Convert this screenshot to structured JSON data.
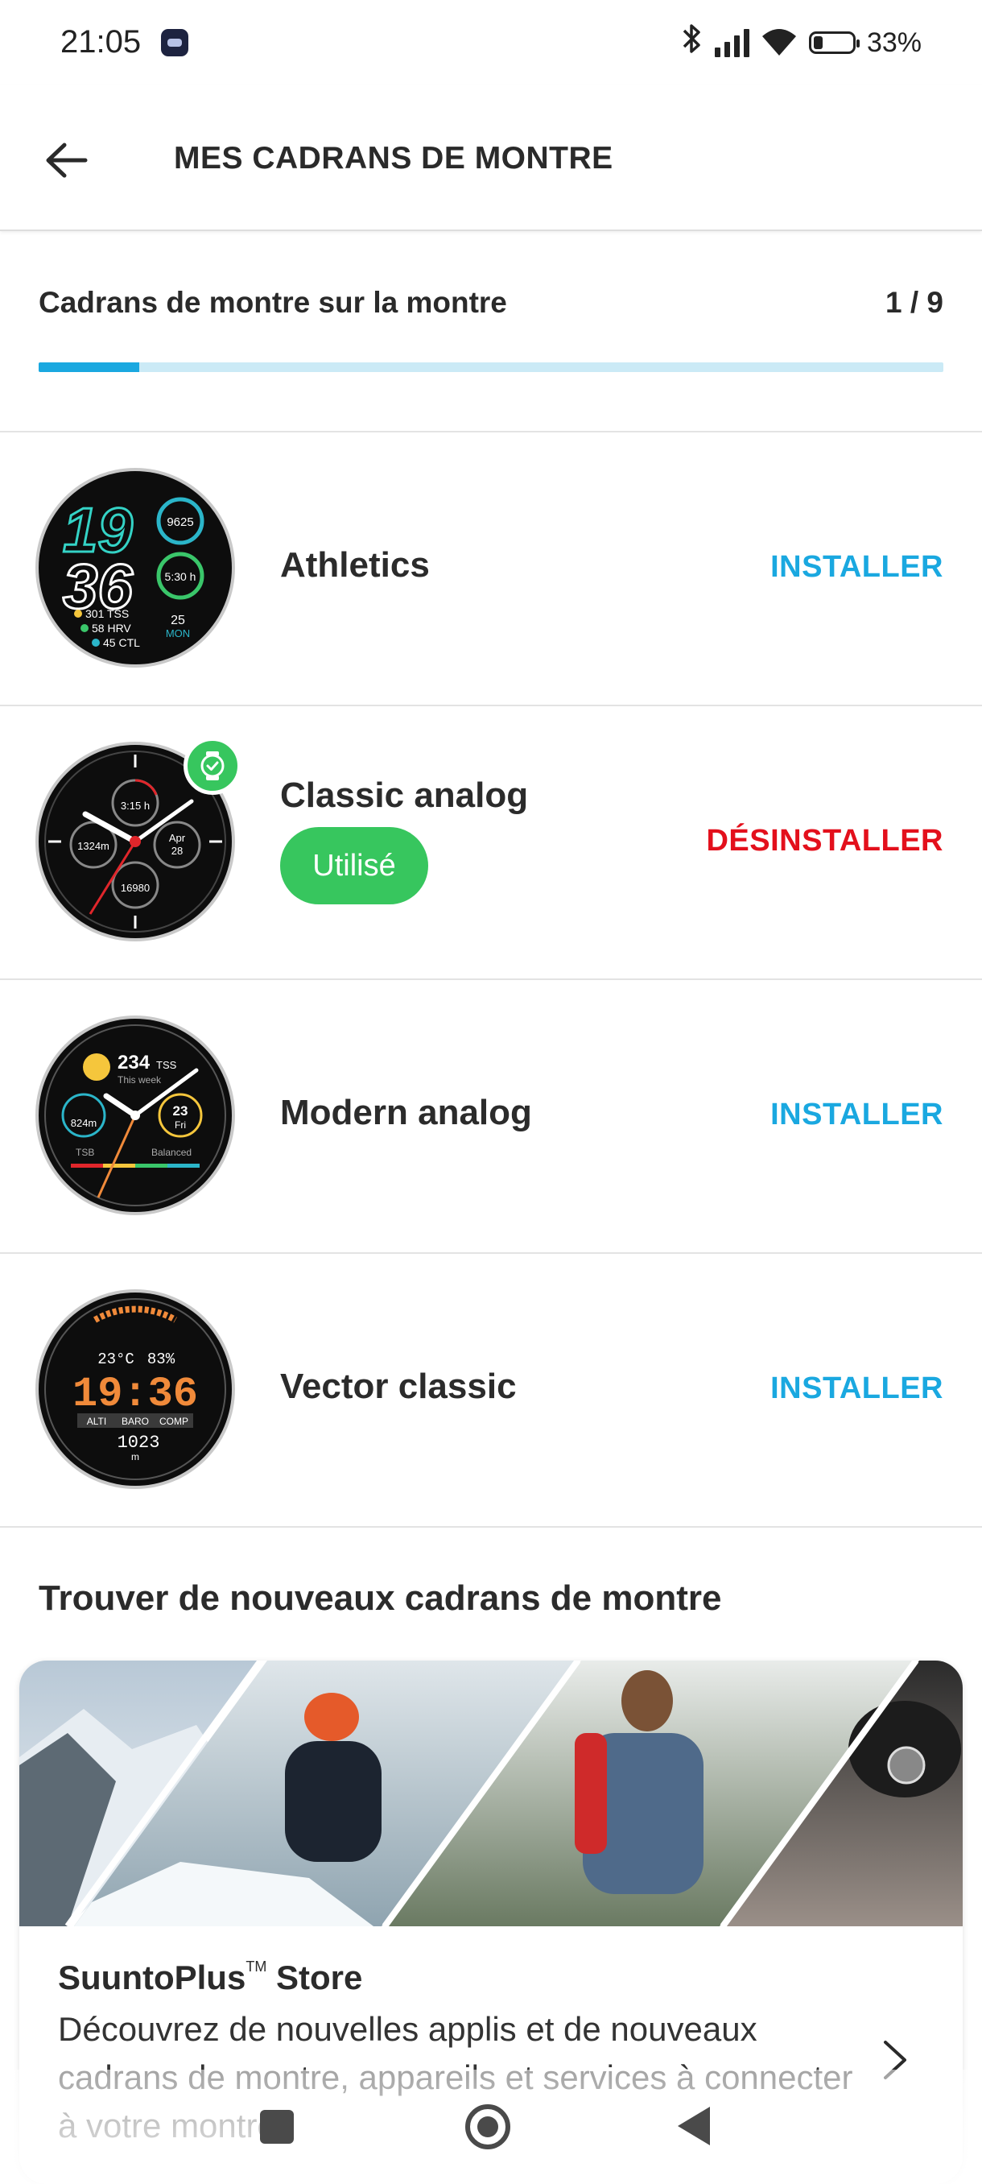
{
  "status_bar": {
    "time": "21:05",
    "app_icon": "notification-app-icon",
    "bluetooth_icon": "bluetooth-icon",
    "signal_icon": "cellular-signal-icon",
    "wifi_icon": "wifi-icon",
    "battery_icon": "battery-icon",
    "battery_percent": "33%",
    "battery_level": 0.33
  },
  "app_bar": {
    "back_icon": "arrow-back-icon",
    "title": "MES CADRANS DE MONTRE"
  },
  "installed_progress": {
    "label": "Cadrans de montre sur la montre",
    "count": "1 / 9",
    "fraction": 0.111
  },
  "colors": {
    "accent": "#1aa8e0",
    "danger": "#e3101c",
    "used_green": "#37c65e"
  },
  "watch_faces": [
    {
      "name": "Athletics",
      "action": "INSTALLER",
      "thumbnail": {
        "hours": "19",
        "minutes": "36",
        "steps": "9625",
        "sleep": "5:30 h",
        "tss": "301 TSS",
        "hrv": "58 HRV",
        "ctl": "45 CTL",
        "day": "25",
        "weekday": "MON"
      }
    },
    {
      "name": "Classic analog",
      "badge": "Utilisé",
      "action": "DÉSINSTALLER",
      "active_icon": "watch-check-icon",
      "thumbnail": {
        "top": "3:15 h",
        "left": "1324m",
        "right_top": "Apr",
        "right_bottom": "28",
        "bottom": "16980"
      }
    },
    {
      "name": "Modern analog",
      "action": "INSTALLER",
      "thumbnail": {
        "tss": "234",
        "tss_unit": "TSS",
        "week": "This week",
        "left": "824m",
        "right_top": "23",
        "right_bottom": "Fri",
        "tsb": "TSB",
        "balanced": "Balanced"
      }
    },
    {
      "name": "Vector classic",
      "action": "INSTALLER",
      "thumbnail": {
        "temp": "23°C",
        "pct": "83%",
        "time": "19:36",
        "alti": "ALTI",
        "baro": "BARO",
        "comp": "COMP",
        "alt_value": "1023",
        "alt_unit": "m"
      }
    }
  ],
  "find_section": {
    "title": "Trouver de nouveaux cadrans de montre"
  },
  "store_card": {
    "title": "SuuntoPlus",
    "trademark": "TM",
    "title_suffix": " Store",
    "description": "Découvrez de nouvelles applis et de nouveaux cadrans de montre, appareils et services à connecter à votre montre",
    "chevron_icon": "chevron-right-icon"
  },
  "nav_bar": {
    "recents_icon": "recents-square-icon",
    "home_icon": "home-circle-icon",
    "back_icon": "back-triangle-icon"
  }
}
